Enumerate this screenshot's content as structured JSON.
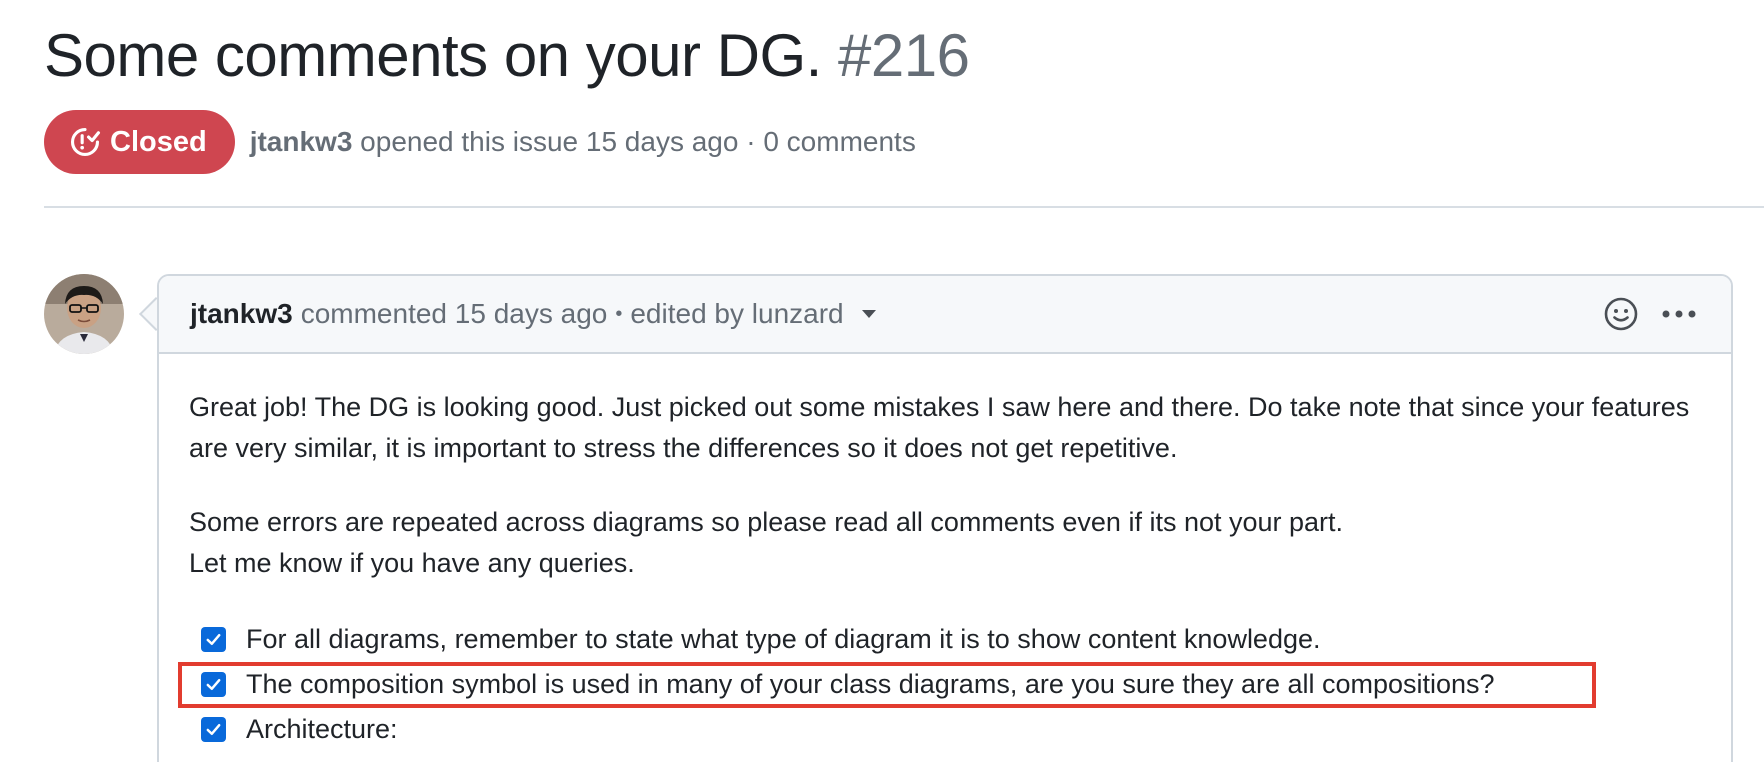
{
  "issue": {
    "title": "Some comments on your DG.",
    "number": "#216",
    "state": "Closed",
    "author": "jtankw3",
    "opened_text": "opened this issue 15 days ago · 0 comments"
  },
  "comment": {
    "author": "jtankw3",
    "commented_text": "commented 15 days ago",
    "separator": "•",
    "edited_text": "edited by lunzard",
    "paragraphs": [
      "Great job! The DG is looking good. Just picked out some mistakes I saw here and there. Do take note that since your features are very similar, it is important to stress the differences so it does not get repetitive.",
      "Some errors are repeated across diagrams so please read all comments even if its not your part.",
      "Let me know if you have any queries."
    ],
    "tasks": [
      {
        "label": "For all diagrams, remember to state what type of diagram it is to show content knowledge.",
        "checked": true
      },
      {
        "label": "The composition symbol is used in many of your class diagrams, are you sure they are all compositions?",
        "checked": true,
        "highlighted": true
      },
      {
        "label": "Architecture:",
        "checked": true
      }
    ]
  },
  "icons": {
    "state": "issue-closed-icon",
    "avatar": "user-avatar",
    "caret": "caret-down-icon",
    "reaction": "smiley-icon",
    "more": "kebab-horizontal-icon",
    "checkbox": "check-icon"
  },
  "colors": {
    "closed_badge": "#cf4650",
    "checkbox": "#0969da",
    "highlight": "#e23c2f",
    "muted_text": "#656d76"
  }
}
